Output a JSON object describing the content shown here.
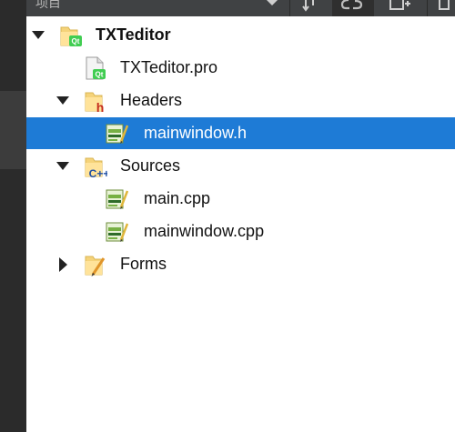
{
  "toolbar": {
    "title": "项目",
    "buttons": [
      "dropdown-button",
      "sync-button",
      "split-button",
      "new-window-button"
    ]
  },
  "tree": {
    "project": {
      "label": "TXTeditor",
      "expanded": true
    },
    "pro_file": {
      "label": "TXTeditor.pro"
    },
    "headers": {
      "label": "Headers",
      "expanded": true
    },
    "header_file": {
      "label": "mainwindow.h",
      "selected": true
    },
    "sources": {
      "label": "Sources",
      "expanded": true
    },
    "source_main": {
      "label": "main.cpp"
    },
    "source_mainwindow": {
      "label": "mainwindow.cpp"
    },
    "forms": {
      "label": "Forms",
      "expanded": false
    }
  },
  "colors": {
    "selection": "#1e7bd6",
    "panel_bg": "#ffffff",
    "rail_bg": "#2b2b2b",
    "toolbar_bg": "#404244",
    "folder": "#f5d37a",
    "qt_green": "#41cd52"
  }
}
